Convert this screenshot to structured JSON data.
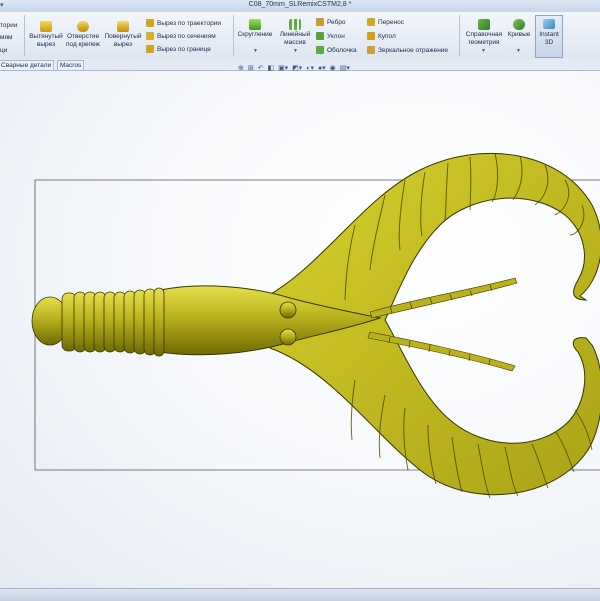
{
  "window": {
    "title": "C08_70mm_SLRemixCSTM2,8 *",
    "quick_access": "▾"
  },
  "ribbon": {
    "left_cut": [
      "тории",
      "мям",
      "ци"
    ],
    "extrude_boss": "Вытянутый вырез",
    "hole_wizard": "Отверстие под крепеж",
    "revolve_cut": "Повернутый вырез",
    "cut_sweep": "Вырез по траектории",
    "cut_loft": "Вырез по сечениям",
    "cut_boundary": "Вырез по границе",
    "fillet": "Скругление",
    "linear_pattern": "Линейный массив",
    "rib": "Ребро",
    "draft": "Уклон",
    "shell": "Оболочка",
    "wrap": "Перенос",
    "dome": "Купол",
    "mirror": "Зеркальное отражение",
    "ref_geometry": "Справочная геометрия",
    "curves": "Кривые",
    "instant3d": "Instant 3D"
  },
  "tabs": [
    {
      "label": "Сварные детали"
    },
    {
      "label": "Macros"
    }
  ],
  "viewtools_icons": [
    "zoom-fit-icon",
    "zoom-area-icon",
    "previous-view-icon",
    "section-view-icon",
    "view-orientation-icon",
    "display-style-icon",
    "hide-show-icon",
    "edit-appearance-icon",
    "apply-scene-icon",
    "view-settings-icon"
  ],
  "colors": {
    "model_fill": "#b9b21d",
    "model_dark": "#6f6a05",
    "model_light": "#e6df4c",
    "outline": "#3a3600"
  }
}
